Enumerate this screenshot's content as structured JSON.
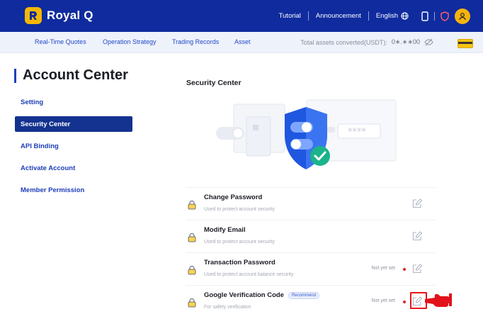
{
  "app": {
    "name": "Royal Q"
  },
  "topbar": {
    "links": [
      "Tutorial",
      "Announcement",
      "English"
    ],
    "icons": [
      "phone-icon",
      "shield-icon",
      "user-avatar-icon"
    ]
  },
  "subnav": {
    "tabs": [
      "Real-Time Quotes",
      "Operation Strategy",
      "Trading Records",
      "Asset"
    ],
    "assets_label": "Total assets converted(USDT):",
    "assets_value": "0∗.∗∗00"
  },
  "sidebar": {
    "title": "Account Center",
    "items": [
      {
        "label": "Setting",
        "active": false
      },
      {
        "label": "Security Center",
        "active": true
      },
      {
        "label": "API Binding",
        "active": false
      },
      {
        "label": "Activate Account",
        "active": false
      },
      {
        "label": "Member Permission",
        "active": false
      }
    ]
  },
  "main": {
    "section_title": "Security Center",
    "illustration": {
      "masked_code": "****"
    },
    "rows": [
      {
        "title": "Change Password",
        "desc": "Used to protect account security",
        "status": "",
        "badge": ""
      },
      {
        "title": "Modify Email",
        "desc": "Used to protect account security",
        "status": "",
        "badge": ""
      },
      {
        "title": "Transaction Password",
        "desc": "Used to protect account balance security",
        "status": "Not yet set",
        "badge": ""
      },
      {
        "title": "Google Verification Code",
        "desc": "For safety verification",
        "status": "Not yet set",
        "badge": "Recommend"
      }
    ]
  },
  "colors": {
    "topbar": "#0f2b9e",
    "accent": "#1a40c0",
    "brand_yellow": "#f5b700",
    "status_dot": "#e02525",
    "highlight": "#e8141a"
  }
}
